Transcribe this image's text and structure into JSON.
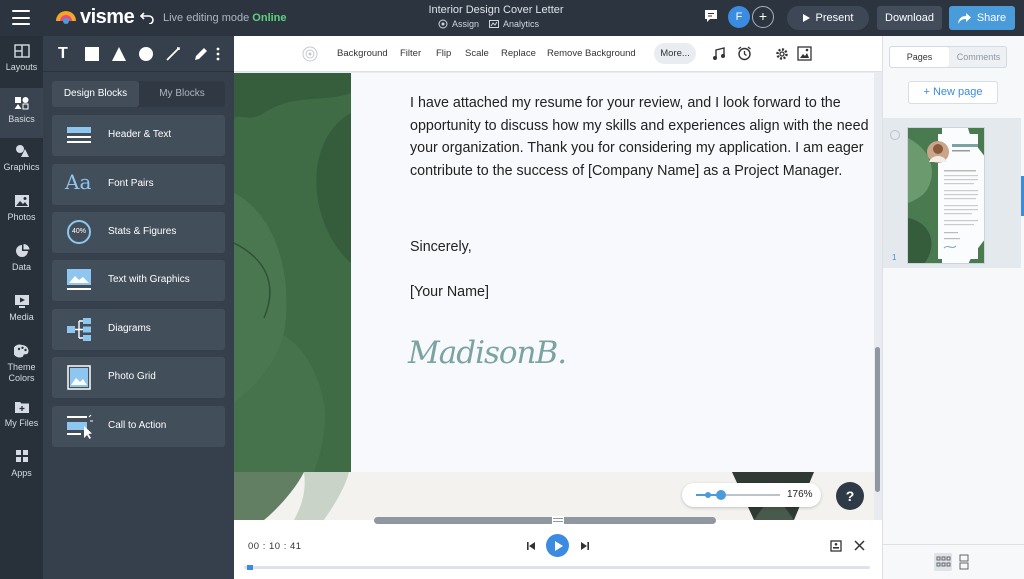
{
  "app": {
    "brand": "visme",
    "mode_label": "Live editing mode",
    "mode_status": "Online",
    "doc_title": "Interior Design Cover Letter",
    "assign_label": "Assign",
    "analytics_label": "Analytics",
    "avatar_initial": "F",
    "add_collaborator": "+",
    "present_label": "Present",
    "download_label": "Download",
    "share_label": "Share"
  },
  "rail": {
    "items": [
      {
        "label": "Layouts",
        "icon": "layouts-icon"
      },
      {
        "label": "Basics",
        "icon": "basics-icon",
        "active": true
      },
      {
        "label": "Graphics",
        "icon": "graphics-icon"
      },
      {
        "label": "Photos",
        "icon": "photos-icon"
      },
      {
        "label": "Data",
        "icon": "data-icon"
      },
      {
        "label": "Media",
        "icon": "media-icon"
      },
      {
        "label": "Theme Colors",
        "icon": "theme-colors-icon"
      },
      {
        "label": "My Files",
        "icon": "my-files-icon"
      },
      {
        "label": "Apps",
        "icon": "apps-icon"
      }
    ]
  },
  "panel": {
    "tools": [
      "text-tool-icon",
      "rectangle-tool-icon",
      "triangle-tool-icon",
      "circle-tool-icon",
      "line-tool-icon",
      "pen-tool-icon",
      "more-vertical-icon"
    ],
    "text_tool_glyph": "T",
    "tabs": [
      "Design Blocks",
      "My Blocks"
    ],
    "blocks": [
      {
        "label": "Header & Text",
        "icon": "header-text-icon"
      },
      {
        "label": "Font Pairs",
        "icon": "font-pairs-icon"
      },
      {
        "label": "Stats & Figures",
        "icon": "stats-figures-icon",
        "glyph": "40%"
      },
      {
        "label": "Text with Graphics",
        "icon": "text-graphics-icon"
      },
      {
        "label": "Diagrams",
        "icon": "diagrams-icon"
      },
      {
        "label": "Photo Grid",
        "icon": "photo-grid-icon"
      },
      {
        "label": "Call to Action",
        "icon": "call-to-action-icon"
      }
    ],
    "font_pairs_glyph": "Aa"
  },
  "subtoolbar": {
    "items": [
      "Background",
      "Filter",
      "Flip",
      "Scale",
      "Replace",
      "Remove Background"
    ],
    "more_label": "More..."
  },
  "letter": {
    "lines": [
      "I have attached my resume for your review, and I look forward to the",
      "opportunity to discuss how my skills and experiences align with the need",
      "your organization. Thank you for considering my application. I am eager",
      "contribute to the success of [Company Name] as a Project Manager."
    ],
    "closing": "Sincerely,",
    "name": "[Your Name]",
    "signature": "MadisonB."
  },
  "zoom": {
    "value": "176%",
    "level": 0.3
  },
  "help_label": "?",
  "timeline": {
    "time": "00 : 10 : 41",
    "progress": 0.01
  },
  "right_panel": {
    "tabs": [
      "Pages",
      "Comments"
    ],
    "new_page_label": "+ New page",
    "page_number": "1",
    "thumb_name": "Madison Beerot"
  },
  "colors": {
    "topbar": "#2c3440",
    "panel": "#36404c",
    "accent": "#3b8be0",
    "online": "#5fd17e",
    "leaf_green": "#3f6b45",
    "signature": "#7ba3a2"
  }
}
